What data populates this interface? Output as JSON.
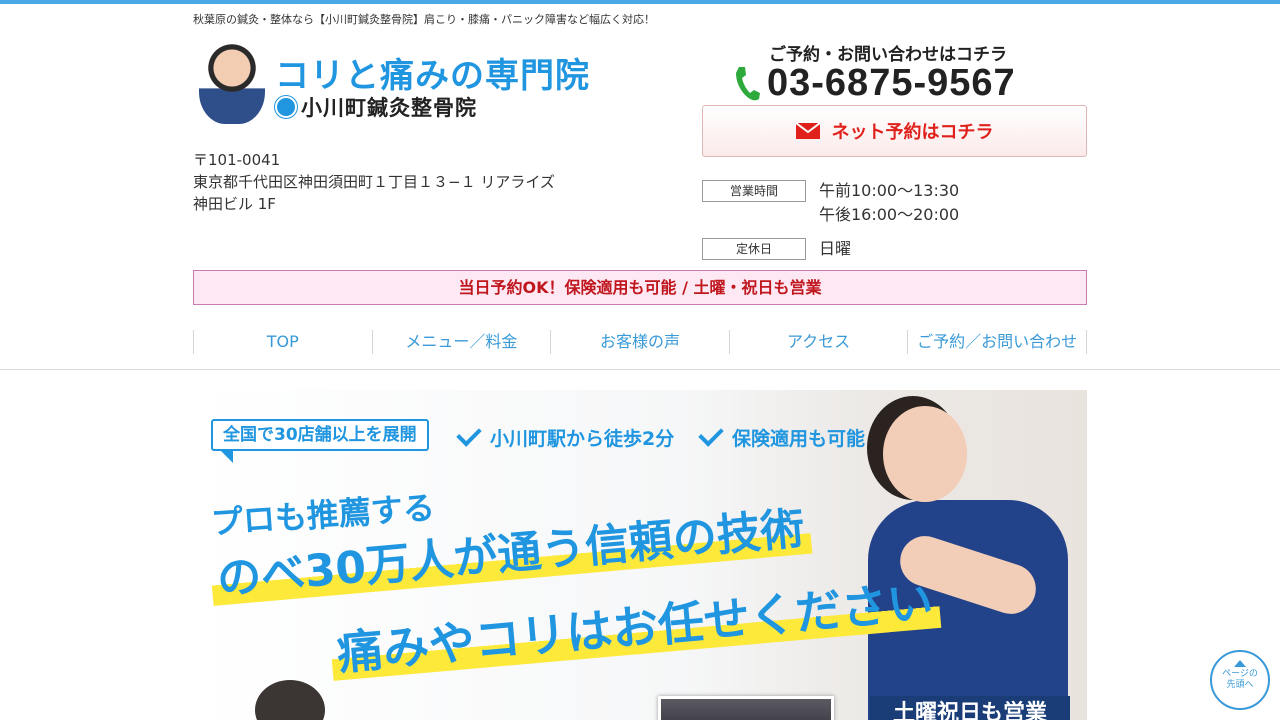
{
  "header": {
    "tagline": "秋葉原の鍼灸・整体なら【小川町鍼灸整骨院】肩こり・膝痛・パニック障害など幅広く対応！",
    "logo_title": "コリと痛みの専門院",
    "logo_subtitle": "小川町鍼灸整骨院",
    "address": [
      "〒101-0041",
      "東京都千代田区神田須田町１丁目１３−１ リアライズ",
      "神田ビル 1F"
    ]
  },
  "contact": {
    "lead": "ご予約・お問い合わせはコチラ",
    "phone": "03-6875-9567",
    "reserve_label": "ネット予約はコチラ",
    "hours": [
      {
        "key": "営業時間",
        "values": [
          "午前10:00〜13:30",
          "午後16:00〜20:00"
        ]
      },
      {
        "key": "定休日",
        "values": [
          "日曜"
        ]
      }
    ]
  },
  "notice": "当日予約OK！保険適用も可能 / 土曜・祝日も営業",
  "nav": [
    "TOP",
    "メニュー／料金",
    "お客様の声",
    "アクセス",
    "ご予約／お問い合わせ"
  ],
  "hero": {
    "badge": "全国で30店舗以上を展開",
    "checks": [
      "小川町駅から徒歩2分",
      "保険適用も可能"
    ],
    "pro": "プロも推薦する",
    "line1": "のべ30万人が通う信頼の技術",
    "line2": "痛みやコリはお任せください",
    "sat_tag": "土曜祝日も営業"
  },
  "to_top": "ページの\n先頭へ",
  "colors": {
    "accent": "#2196e0",
    "alert": "#e0201b",
    "nav": "#3a9ad8",
    "phone_icon": "#2eaa3c"
  }
}
